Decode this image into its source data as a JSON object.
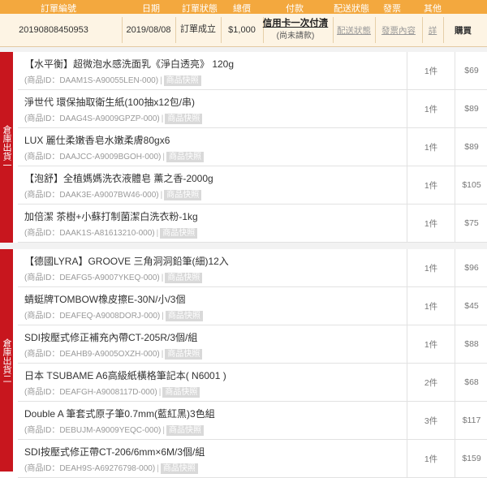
{
  "header": {
    "order_no": "訂單編號",
    "date": "日期",
    "status": "訂單狀態",
    "total": "總價",
    "payment": "付款",
    "shipping_status": "配送狀態",
    "invoice": "發票",
    "other": "其他"
  },
  "order": {
    "order_no": "20190808450953",
    "date": "2019/08/08",
    "status": "訂單成立",
    "total": "$1,000",
    "payment_method": "信用卡一次付清",
    "payment_note": "(尚未請款)",
    "shipping_link": "配送狀態",
    "invoice_link": "發票內容",
    "detail_link": "詳",
    "extra": "購買"
  },
  "snapshot_label": "商品快照",
  "groups": [
    {
      "label": "倉庫出貨一",
      "items": [
        {
          "name": "【水平衡】超微泡水感洗面乳《淨白透亮》 120g",
          "id": "(商品ID：DAAM1S-A90055LEN-000)",
          "qty": "1件",
          "price": "$69"
        },
        {
          "name": "淨世代 環保抽取衛生紙(100抽x12包/串)",
          "id": "(商品ID：DAAG4S-A9009GPZP-000)",
          "qty": "1件",
          "price": "$89"
        },
        {
          "name": "LUX 麗仕柔嫩香皂水嫩柔膚80gx6",
          "id": "(商品ID：DAAJCC-A9009BGOH-000)",
          "qty": "1件",
          "price": "$89"
        },
        {
          "name": "【泡舒】全植媽媽洗衣液體皂 薰之香-2000g",
          "id": "(商品ID：DAAK3E-A9007BW46-000)",
          "qty": "1件",
          "price": "$105"
        },
        {
          "name": "加倍潔 茶樹+小蘇打制菌潔白洗衣粉-1kg",
          "id": "(商品ID：DAAK1S-A81613210-000)",
          "qty": "1件",
          "price": "$75"
        }
      ]
    },
    {
      "label": "倉庫出貨二",
      "items": [
        {
          "name": "【德國LYRA】GROOVE 三角洞洞鉛筆(細)12入",
          "id": "(商品ID：DEAFG5-A9007YKEQ-000)",
          "qty": "1件",
          "price": "$96"
        },
        {
          "name": "蜻蜓牌TOMBOW橡皮擦E-30N/小/3個",
          "id": "(商品ID：DEAFEQ-A9008DORJ-000)",
          "qty": "1件",
          "price": "$45"
        },
        {
          "name": "SDI按壓式修正補充內帶CT-205R/3個/組",
          "id": "(商品ID：DEAHB9-A9005OXZH-000)",
          "qty": "1件",
          "price": "$88"
        },
        {
          "name": "日本 TSUBAME A6高級紙橫格筆記本( N6001 )",
          "id": "(商品ID：DEAFGH-A9008117D-000)",
          "qty": "2件",
          "price": "$68"
        },
        {
          "name": "Double A 筆套式原子筆0.7mm(藍紅黑)3色組",
          "id": "(商品ID：DEBUJM-A9009YEQC-000)",
          "qty": "3件",
          "price": "$117"
        },
        {
          "name": "SDI按壓式修正帶CT-206/6mm×6M/3個/組",
          "id": "(商品ID：DEAH9S-A69276798-000)",
          "qty": "1件",
          "price": "$159"
        }
      ]
    }
  ]
}
